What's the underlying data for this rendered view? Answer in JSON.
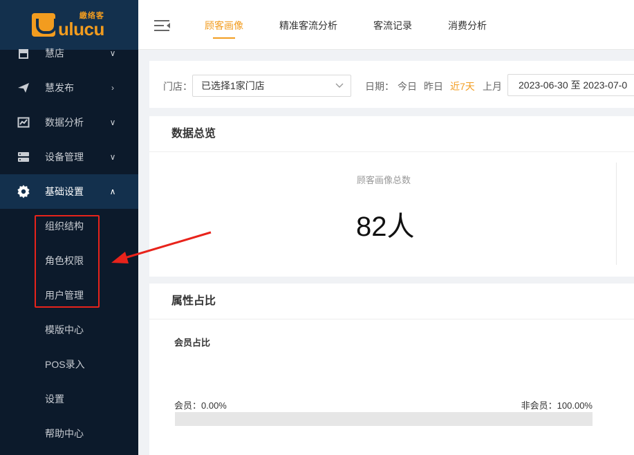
{
  "logo": {
    "cn": "繳络客",
    "en": "ulucu"
  },
  "sidebar": {
    "items": [
      {
        "label": "慧店",
        "icon": "store-icon",
        "arrow": "chevron-down"
      },
      {
        "label": "慧发布",
        "icon": "send-icon",
        "arrow": "chevron-right"
      },
      {
        "label": "数据分析",
        "icon": "chart-icon",
        "arrow": "chevron-down"
      },
      {
        "label": "设备管理",
        "icon": "server-icon",
        "arrow": "chevron-down"
      },
      {
        "label": "基础设置",
        "icon": "gear-icon",
        "arrow": "chevron-up"
      }
    ],
    "sub_items": [
      "组织结构",
      "角色权限",
      "用户管理",
      "模版中心",
      "POS录入",
      "设置",
      "帮助中心"
    ]
  },
  "header": {
    "tabs": [
      "顾客画像",
      "精准客流分析",
      "客流记录",
      "消费分析"
    ],
    "active_tab": 0
  },
  "filter": {
    "store_label": "门店：",
    "store_value": "已选择1家门店",
    "date_label": "日期：",
    "date_options": [
      "今日",
      "昨日",
      "近7天",
      "上月"
    ],
    "date_selected": "近7天",
    "date_range": "2023-06-30 至 2023-07-0"
  },
  "overview": {
    "title": "数据总览",
    "stat_label": "顾客画像总数",
    "stat_value": "82人"
  },
  "attributes": {
    "title": "属性占比",
    "member_section": "会员占比",
    "member_label": "会员：0.00%",
    "non_member_label": "非会员：100.00%",
    "member_ratio": 0.0
  },
  "colors": {
    "accent": "#f29c1f",
    "sidebar_bg": "#0c1a2b",
    "sidebar_active": "#13304d",
    "annotation_red": "#e8231b"
  }
}
